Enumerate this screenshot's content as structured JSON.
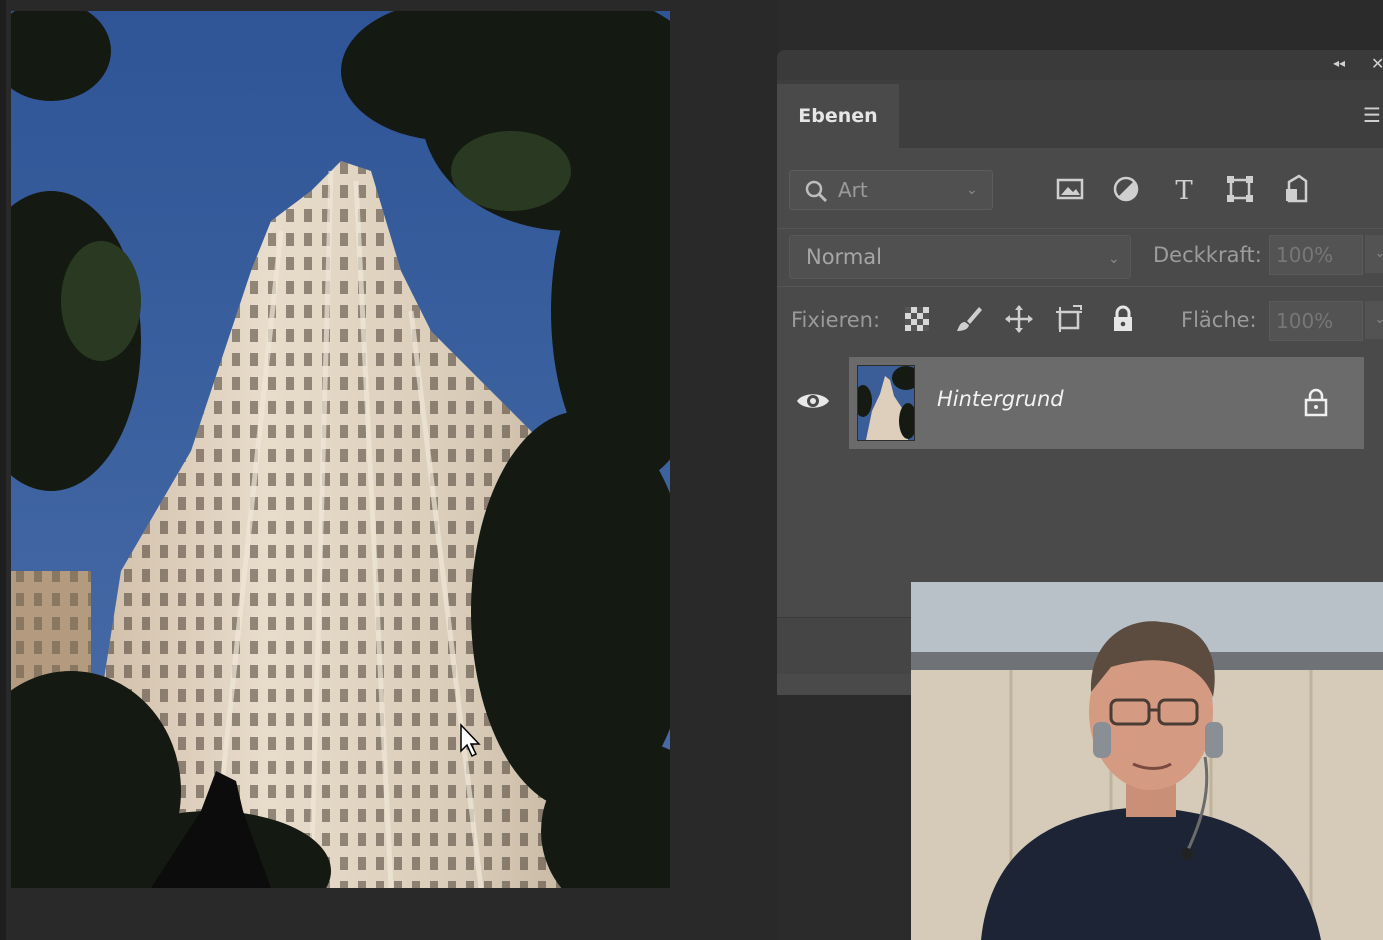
{
  "panel": {
    "tab_label": "Ebenen",
    "collapse_icon": "double-chevron-left-icon",
    "close_icon": "close-icon",
    "menu_icon": "hamburger-menu-icon",
    "filter": {
      "type_value": "Art",
      "icons": [
        "image-filter-icon",
        "adjustment-filter-icon",
        "text-filter-icon",
        "shape-filter-icon",
        "smart-object-filter-icon"
      ]
    },
    "blend_mode": "Normal",
    "opacity_label": "Deckkraft:",
    "opacity_value": "100%",
    "lock_label": "Fixieren:",
    "lock_icons": [
      "lock-transparency-icon",
      "lock-image-pixels-icon",
      "lock-position-icon",
      "lock-artboard-icon",
      "lock-all-icon"
    ],
    "fill_label": "Fläche:",
    "fill_value": "100%",
    "layers": [
      {
        "name": "Hintergrund",
        "visible": true,
        "locked": true
      }
    ]
  },
  "colors": {
    "panel_bg": "#4a4a4a",
    "app_bg": "#2b2b2b",
    "selected_layer": "#6b6b6b",
    "sky": "#3d5f97"
  }
}
